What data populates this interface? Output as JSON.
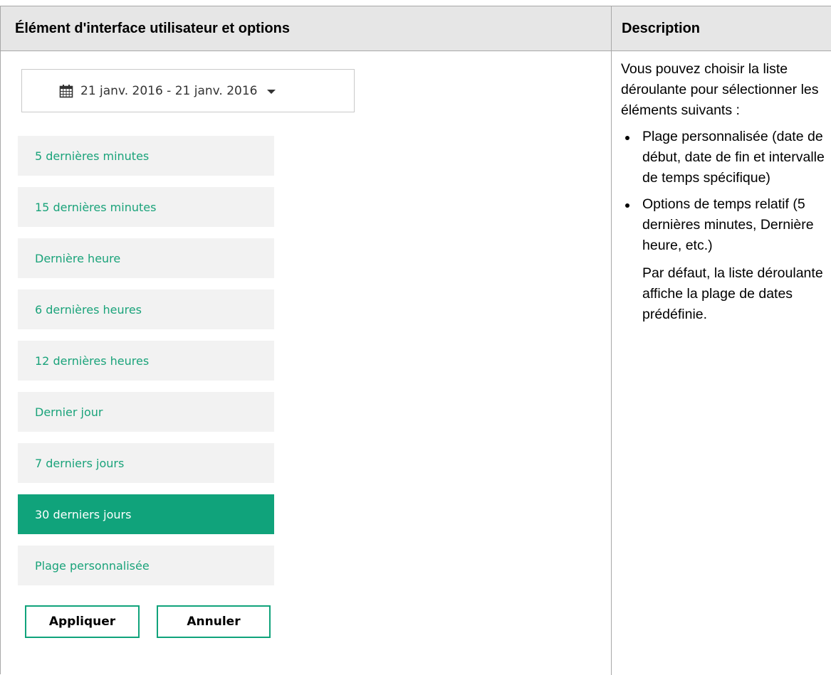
{
  "table": {
    "headers": {
      "left": "Élément d'interface utilisateur et options",
      "right": "Description"
    }
  },
  "date_picker": {
    "icon": "calendar-icon",
    "value": "21 janv. 2016 - 21 janv. 2016"
  },
  "range_options": [
    {
      "label": "5 dernières minutes",
      "selected": false
    },
    {
      "label": "15 dernières minutes",
      "selected": false
    },
    {
      "label": "Dernière heure",
      "selected": false
    },
    {
      "label": "6 dernières heures",
      "selected": false
    },
    {
      "label": "12 dernières heures",
      "selected": false
    },
    {
      "label": "Dernier jour",
      "selected": false
    },
    {
      "label": "7 derniers jours",
      "selected": false
    },
    {
      "label": "30 derniers jours",
      "selected": true
    },
    {
      "label": "Plage personnalisée",
      "selected": false
    }
  ],
  "buttons": {
    "apply": "Appliquer",
    "cancel": "Annuler"
  },
  "description": {
    "intro": "Vous pouvez choisir la liste déroulante pour sélectionner les éléments suivants :",
    "bullets": [
      "Plage personnalisée (date de début, date de fin et intervalle de temps spécifique)",
      "Options de temps relatif (5 dernières minutes, Dernière heure, etc.)"
    ],
    "note": "Par défaut, la liste déroulante affiche la plage de dates prédéfinie."
  },
  "colors": {
    "accent": "#10a37b",
    "option_text": "#1aa37a",
    "option_bg": "#f2f2f2",
    "header_bg": "#e6e6e6"
  }
}
